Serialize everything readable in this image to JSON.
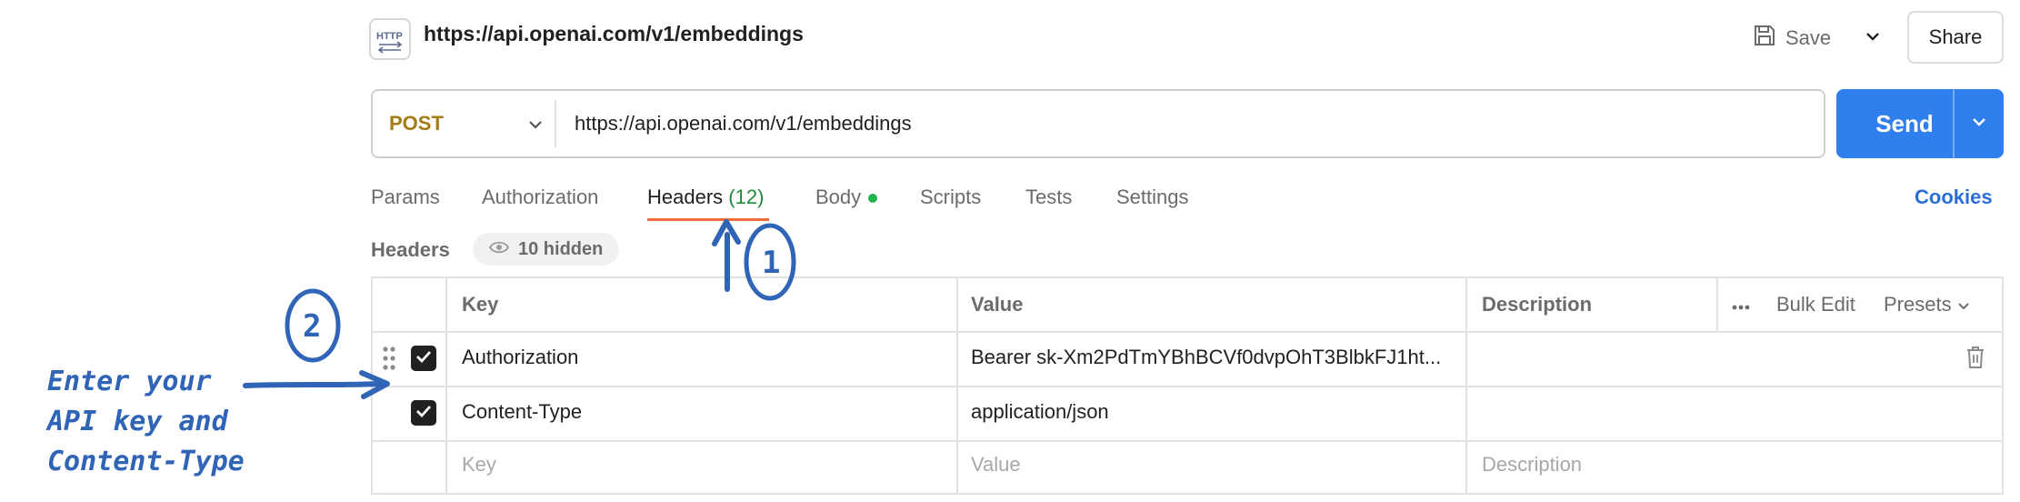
{
  "request": {
    "title": "https://api.openai.com/v1/embeddings",
    "save_label": "Save",
    "share_label": "Share",
    "method": "POST",
    "url": "https://api.openai.com/v1/embeddings",
    "send_label": "Send",
    "method_color": "#a47c14",
    "send_color": "#2f80ed"
  },
  "tabs": {
    "params": "Params",
    "authorization": "Authorization",
    "headers": "Headers",
    "headers_count": "(12)",
    "body": "Body",
    "scripts": "Scripts",
    "tests": "Tests",
    "settings": "Settings",
    "active": "Headers",
    "cookies": "Cookies"
  },
  "headers_section": {
    "label": "Headers",
    "hidden_label": "10 hidden"
  },
  "table": {
    "columns": {
      "key": "Key",
      "value": "Value",
      "description": "Description"
    },
    "actions": {
      "bulk_edit": "Bulk Edit",
      "presets": "Presets"
    },
    "rows": [
      {
        "checked": true,
        "key": "Authorization",
        "value": "Bearer sk-Xm2PdTmYBhBCVf0dvpOhT3BlbkFJ1ht...",
        "description": ""
      },
      {
        "checked": true,
        "key": "Content-Type",
        "value": "application/json",
        "description": ""
      }
    ],
    "placeholders": {
      "key": "Key",
      "value": "Value",
      "description": "Description"
    }
  },
  "annotations": {
    "marker_1": "1",
    "marker_2": "2",
    "line1": "Enter your",
    "line2": "API key and",
    "line3": "Content-Type",
    "color": "#2f64b6"
  },
  "icons": [
    "http-icon",
    "save-icon",
    "chevron-down-icon",
    "eye-icon",
    "drag-handle-icon",
    "checkmark-icon",
    "more-icon",
    "trash-icon"
  ]
}
